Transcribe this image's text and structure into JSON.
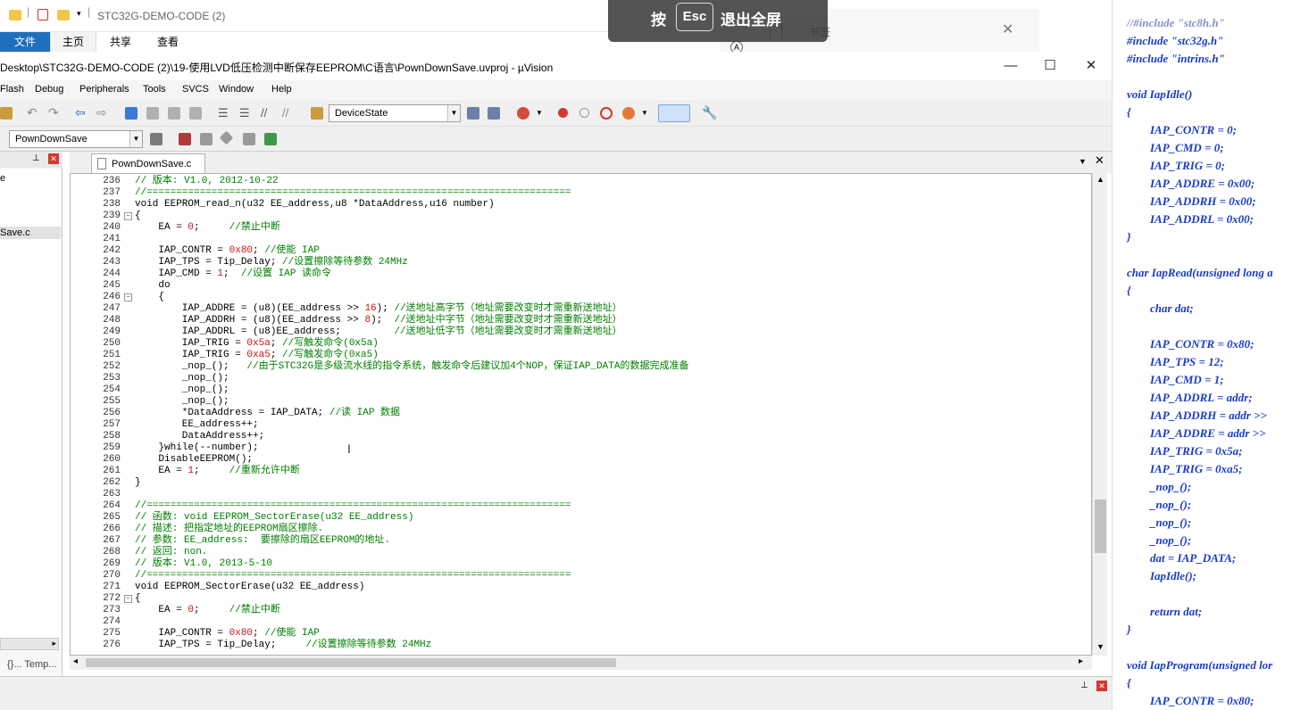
{
  "explorer": {
    "title": "STC32G-DEMO-CODE (2)",
    "tabs": [
      "文件",
      "主页",
      "共享",
      "查看"
    ],
    "esc_hint_pre": "按",
    "esc_key": "Esc",
    "esc_hint_post": "退出全屏",
    "bookmark_label": "书签"
  },
  "uv": {
    "title": "Desktop\\STC32G-DEMO-CODE (2)\\19-使用LVD低压检测中断保存EEPROM\\C语言\\PownDownSave.uvproj - µVision",
    "menu": [
      "Flash",
      "Debug",
      "Peripherals",
      "Tools",
      "SVCS",
      "Window",
      "Help"
    ],
    "toolbar_combo": "DeviceState",
    "target_combo": "PownDownSave",
    "file_tab": "PownDownSave.c",
    "left_tree": [
      "e",
      "Save.c"
    ],
    "left_tabs": "{}...  Temp..."
  },
  "code": [
    {
      "n": "236",
      "fold": "",
      "t": "// 版本: V1.0, 2012-10-22"
    },
    {
      "n": "237",
      "fold": "",
      "t": "//========================================================================"
    },
    {
      "n": "238",
      "fold": "",
      "t": "void EEPROM_read_n(u32 EE_address,u8 *DataAddress,u16 number)"
    },
    {
      "n": "239",
      "fold": "⊟",
      "t": "{"
    },
    {
      "n": "240",
      "fold": "",
      "t": "    EA = 0;     //禁止中断"
    },
    {
      "n": "241",
      "fold": "",
      "t": ""
    },
    {
      "n": "242",
      "fold": "",
      "t": "    IAP_CONTR = 0x80; //使能 IAP"
    },
    {
      "n": "243",
      "fold": "",
      "t": "    IAP_TPS = Tip_Delay; //设置擦除等待参数 24MHz"
    },
    {
      "n": "244",
      "fold": "",
      "t": "    IAP_CMD = 1;  //设置 IAP 读命令"
    },
    {
      "n": "245",
      "fold": "",
      "t": "    do"
    },
    {
      "n": "246",
      "fold": "⊟",
      "t": "    {"
    },
    {
      "n": "247",
      "fold": "",
      "t": "        IAP_ADDRE = (u8)(EE_address >> 16); //送地址高字节（地址需要改变时才需重新送地址）"
    },
    {
      "n": "248",
      "fold": "",
      "t": "        IAP_ADDRH = (u8)(EE_address >> 8);  //送地址中字节（地址需要改变时才需重新送地址）"
    },
    {
      "n": "249",
      "fold": "",
      "t": "        IAP_ADDRL = (u8)EE_address;         //送地址低字节（地址需要改变时才需重新送地址）"
    },
    {
      "n": "250",
      "fold": "",
      "t": "        IAP_TRIG = 0x5a; //写触发命令(0x5a)"
    },
    {
      "n": "251",
      "fold": "",
      "t": "        IAP_TRIG = 0xa5; //写触发命令(0xa5)"
    },
    {
      "n": "252",
      "fold": "",
      "t": "        _nop_();   //由于STC32G是多级流水线的指令系统，触发命令后建议加4个NOP，保证IAP_DATA的数据完成准备"
    },
    {
      "n": "253",
      "fold": "",
      "t": "        _nop_();"
    },
    {
      "n": "254",
      "fold": "",
      "t": "        _nop_();"
    },
    {
      "n": "255",
      "fold": "",
      "t": "        _nop_();"
    },
    {
      "n": "256",
      "fold": "",
      "t": "        *DataAddress = IAP_DATA; //读 IAP 数据"
    },
    {
      "n": "257",
      "fold": "",
      "t": "        EE_address++;"
    },
    {
      "n": "258",
      "fold": "",
      "t": "        DataAddress++;"
    },
    {
      "n": "259",
      "fold": "",
      "t": "    }while(--number);"
    },
    {
      "n": "260",
      "fold": "",
      "t": "    DisableEEPROM();"
    },
    {
      "n": "261",
      "fold": "",
      "t": "    EA = 1;     //重新允许中断"
    },
    {
      "n": "262",
      "fold": "",
      "t": "}"
    },
    {
      "n": "263",
      "fold": "",
      "t": ""
    },
    {
      "n": "264",
      "fold": "",
      "t": "//========================================================================"
    },
    {
      "n": "265",
      "fold": "",
      "t": "// 函数: void EEPROM_SectorErase(u32 EE_address)"
    },
    {
      "n": "266",
      "fold": "",
      "t": "// 描述: 把指定地址的EEPROM扇区擦除."
    },
    {
      "n": "267",
      "fold": "",
      "t": "// 参数: EE_address:  要擦除的扇区EEPROM的地址."
    },
    {
      "n": "268",
      "fold": "",
      "t": "// 返回: non."
    },
    {
      "n": "269",
      "fold": "",
      "t": "// 版本: V1.0, 2013-5-10"
    },
    {
      "n": "270",
      "fold": "",
      "t": "//========================================================================"
    },
    {
      "n": "271",
      "fold": "",
      "t": "void EEPROM_SectorErase(u32 EE_address)"
    },
    {
      "n": "272",
      "fold": "⊟",
      "t": "{"
    },
    {
      "n": "273",
      "fold": "",
      "t": "    EA = 0;     //禁止中断"
    },
    {
      "n": "274",
      "fold": "",
      "t": ""
    },
    {
      "n": "275",
      "fold": "",
      "t": "    IAP_CONTR = 0x80; //使能 IAP"
    },
    {
      "n": "276",
      "fold": "",
      "t": "    IAP_TPS = Tip_Delay;     //设置擦除等待参数 24MHz"
    }
  ],
  "notes": [
    {
      "t": "//#include \"stc8h.h\"",
      "dim": true
    },
    {
      "t": "#include \"stc32g.h\""
    },
    {
      "t": "#include \"intrins.h\""
    },
    {
      "t": ""
    },
    {
      "t": "void IapIdle()"
    },
    {
      "t": "{"
    },
    {
      "t": "        IAP_CONTR = 0;"
    },
    {
      "t": "        IAP_CMD = 0;"
    },
    {
      "t": "        IAP_TRIG = 0;"
    },
    {
      "t": "        IAP_ADDRE = 0x00;"
    },
    {
      "t": "        IAP_ADDRH = 0x00;"
    },
    {
      "t": "        IAP_ADDRL = 0x00;"
    },
    {
      "t": "}"
    },
    {
      "t": ""
    },
    {
      "t": "char IapRead(unsigned long a"
    },
    {
      "t": "{"
    },
    {
      "t": "        char dat;"
    },
    {
      "t": ""
    },
    {
      "t": "        IAP_CONTR = 0x80;"
    },
    {
      "t": "        IAP_TPS = 12;"
    },
    {
      "t": "        IAP_CMD = 1;"
    },
    {
      "t": "        IAP_ADDRL = addr;"
    },
    {
      "t": "        IAP_ADDRH = addr >>"
    },
    {
      "t": "        IAP_ADDRE = addr >>"
    },
    {
      "t": "        IAP_TRIG = 0x5a;"
    },
    {
      "t": "        IAP_TRIG = 0xa5;"
    },
    {
      "t": "        _nop_();"
    },
    {
      "t": "        _nop_();"
    },
    {
      "t": "        _nop_();"
    },
    {
      "t": "        _nop_();"
    },
    {
      "t": "        dat = IAP_DATA;"
    },
    {
      "t": "        IapIdle();"
    },
    {
      "t": ""
    },
    {
      "t": "        return dat;"
    },
    {
      "t": "}"
    },
    {
      "t": ""
    },
    {
      "t": "void IapProgram(unsigned lor"
    },
    {
      "t": "{"
    },
    {
      "t": "        IAP_CONTR = 0x80;"
    }
  ]
}
